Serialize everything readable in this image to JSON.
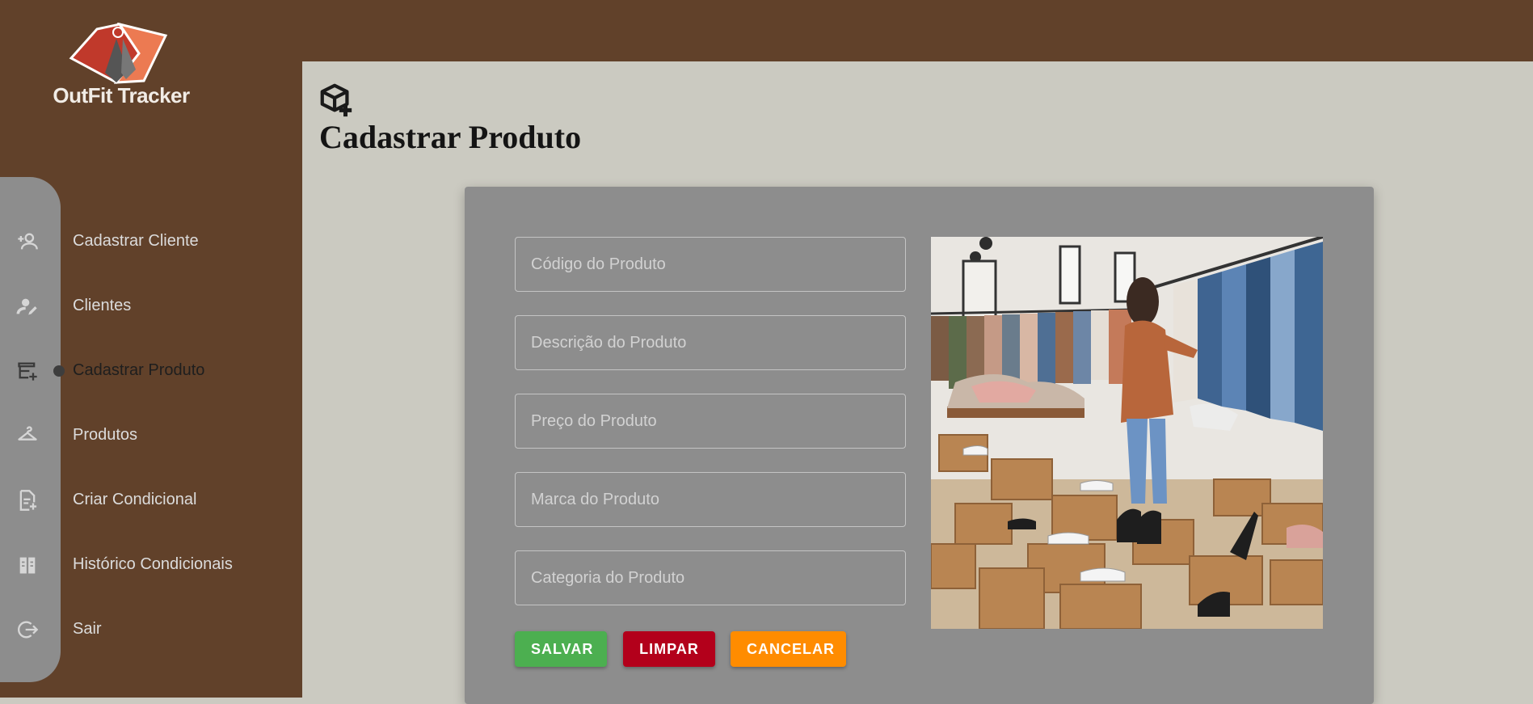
{
  "app": {
    "logo_text": "OutFit Tracker"
  },
  "sidebar": {
    "items": [
      {
        "label": "Cadastrar Cliente",
        "icon": "person-add-icon"
      },
      {
        "label": "Clientes",
        "icon": "person-edit-icon"
      },
      {
        "label": "Cadastrar Produto",
        "icon": "store-add-icon",
        "active": true
      },
      {
        "label": "Produtos",
        "icon": "hanger-icon"
      },
      {
        "label": "Criar Condicional",
        "icon": "document-add-icon"
      },
      {
        "label": "Histórico Condicionais",
        "icon": "book-history-icon"
      },
      {
        "label": "Sair",
        "icon": "logout-icon"
      }
    ]
  },
  "page": {
    "title": "Cadastrar Produto",
    "icon": "package-add-icon"
  },
  "form": {
    "fields": [
      {
        "placeholder": "Código do Produto",
        "value": ""
      },
      {
        "placeholder": "Descrição do Produto",
        "value": ""
      },
      {
        "placeholder": "Preço do Produto",
        "value": ""
      },
      {
        "placeholder": "Marca do Produto",
        "value": ""
      },
      {
        "placeholder": "Categoria do Produto",
        "value": ""
      }
    ],
    "buttons": {
      "save": "SALVAR",
      "clear": "LIMPAR",
      "cancel": "CANCELAR"
    }
  },
  "colors": {
    "brown": "#61412a",
    "save": "#4caf50",
    "clear": "#b3001b",
    "cancel": "#ff8c00"
  }
}
